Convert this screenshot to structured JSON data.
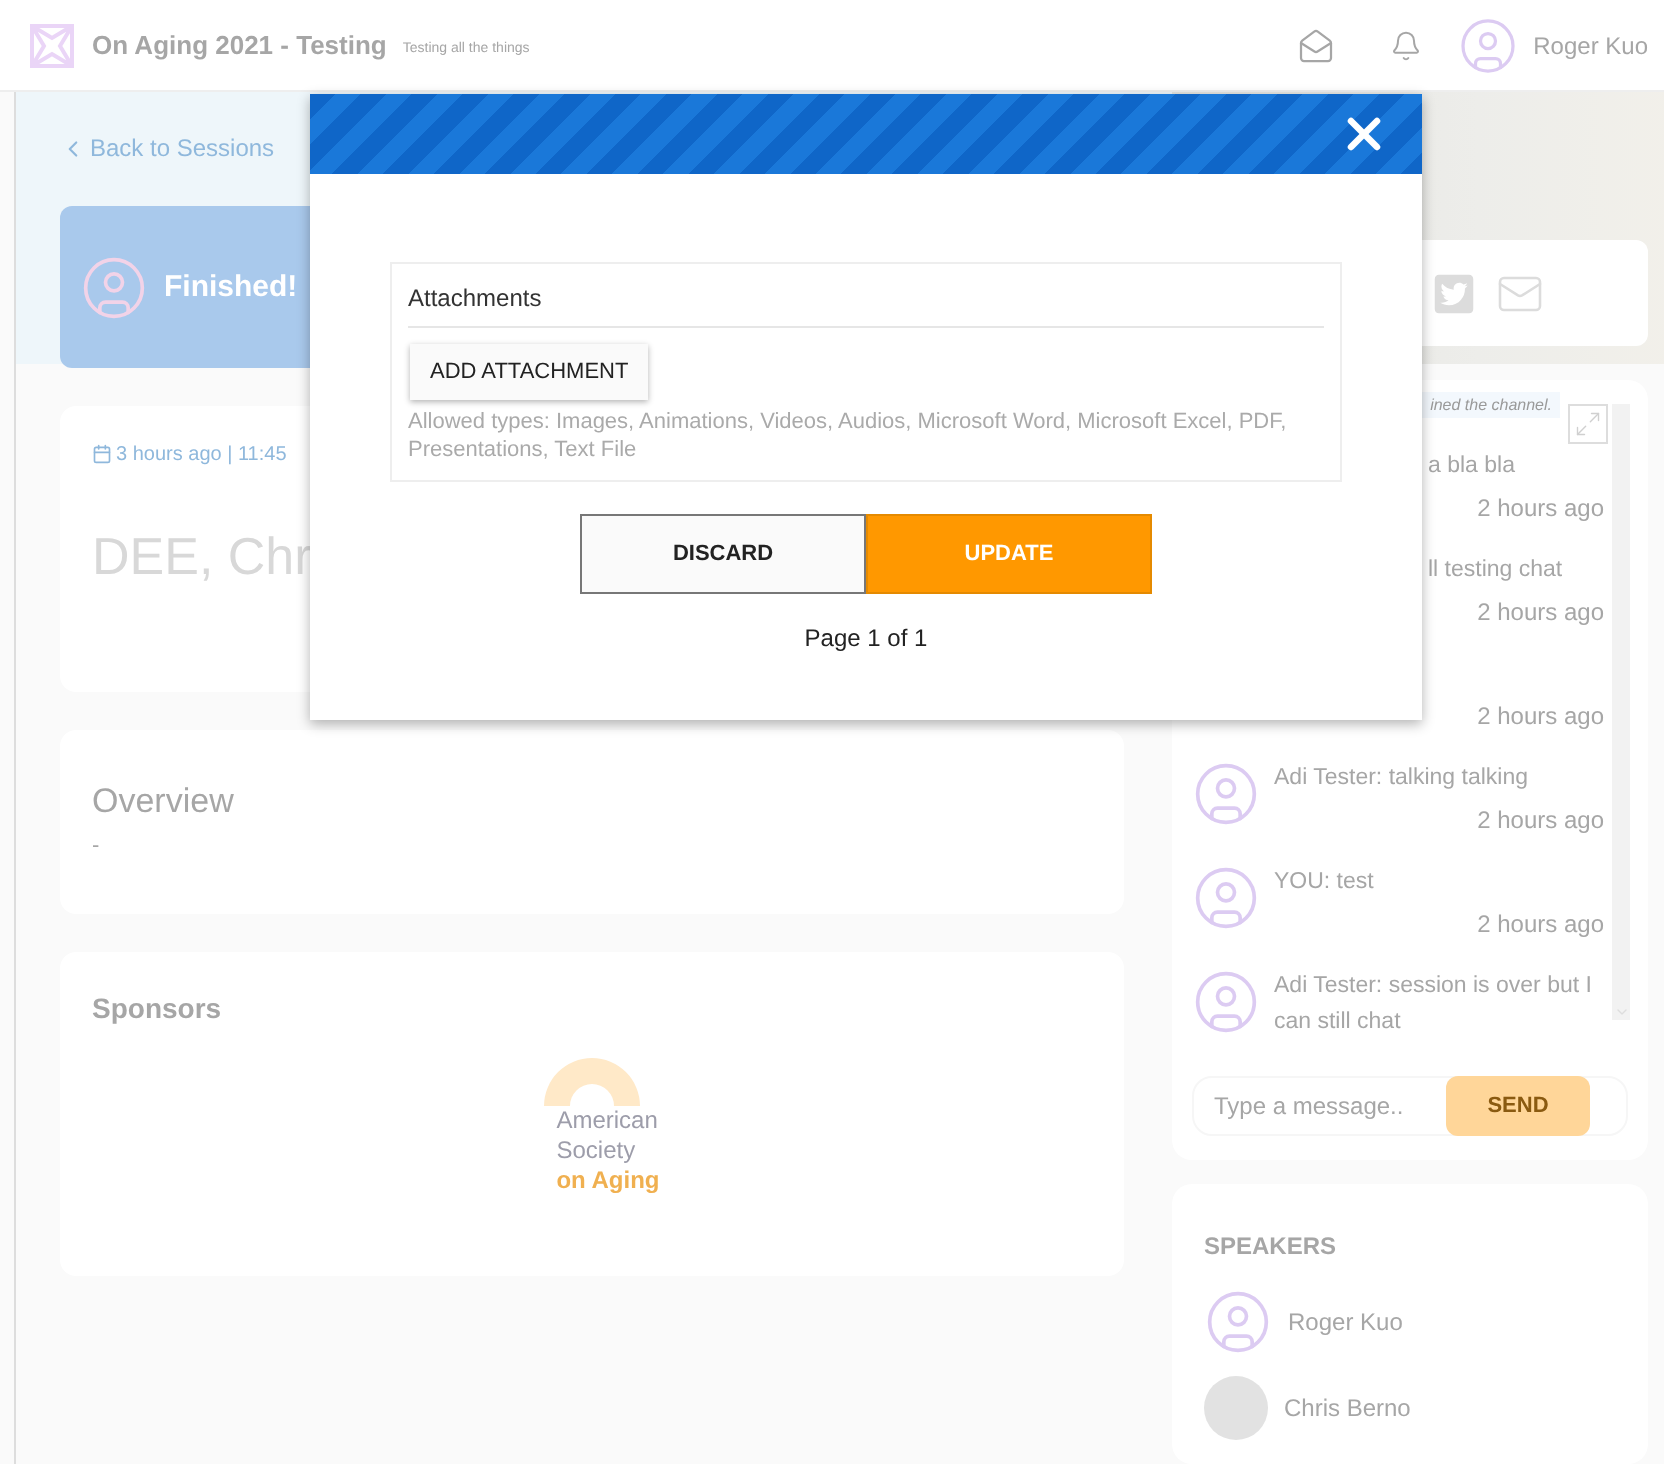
{
  "header": {
    "title": "On Aging 2021 - Testing",
    "subtitle": "Testing all the things",
    "user_name": "Roger Kuo"
  },
  "back_link": "Back to Sessions",
  "status_banner": {
    "text": "Finished!"
  },
  "session": {
    "time": "3 hours ago | 11:45",
    "title": "DEE, Chr"
  },
  "overview": {
    "title": "Overview",
    "text": "-"
  },
  "sponsors": {
    "title": "Sponsors",
    "logo_lines": [
      "American",
      "Society",
      "on Aging"
    ]
  },
  "chat": {
    "notice": "ined the channel.",
    "messages": [
      {
        "kind": "clipped",
        "text": "a bla bla",
        "time": "2 hours ago"
      },
      {
        "kind": "clipped",
        "text": "ll testing chat",
        "time": "2 hours ago"
      },
      {
        "kind": "clipped",
        "time": "2 hours ago"
      },
      {
        "kind": "full",
        "text": "Adi Tester: talking talking",
        "time": "2 hours ago"
      },
      {
        "kind": "full",
        "text": "YOU: test",
        "time": "2 hours ago"
      },
      {
        "kind": "full",
        "text": "Adi Tester: session is over but I can still chat"
      }
    ],
    "input": {
      "placeholder": "Type a message.."
    },
    "send": "SEND"
  },
  "speakers": {
    "title": "SPEAKERS",
    "items": [
      {
        "name": "Roger Kuo",
        "kind": "avatar"
      },
      {
        "name": "Chris Berno",
        "kind": "photo"
      }
    ]
  },
  "modal": {
    "section_title": "Attachments",
    "add_button": "ADD ATTACHMENT",
    "allowed_types": "Allowed types:  Images, Animations, Videos, Audios, Microsoft Word, Microsoft Excel, PDF, Presentations, Text File",
    "buttons": [
      {
        "label": "DISCARD",
        "kind": "secondary"
      },
      {
        "label": "UPDATE",
        "kind": "primary"
      }
    ],
    "pagination": "Page 1 of 1"
  }
}
